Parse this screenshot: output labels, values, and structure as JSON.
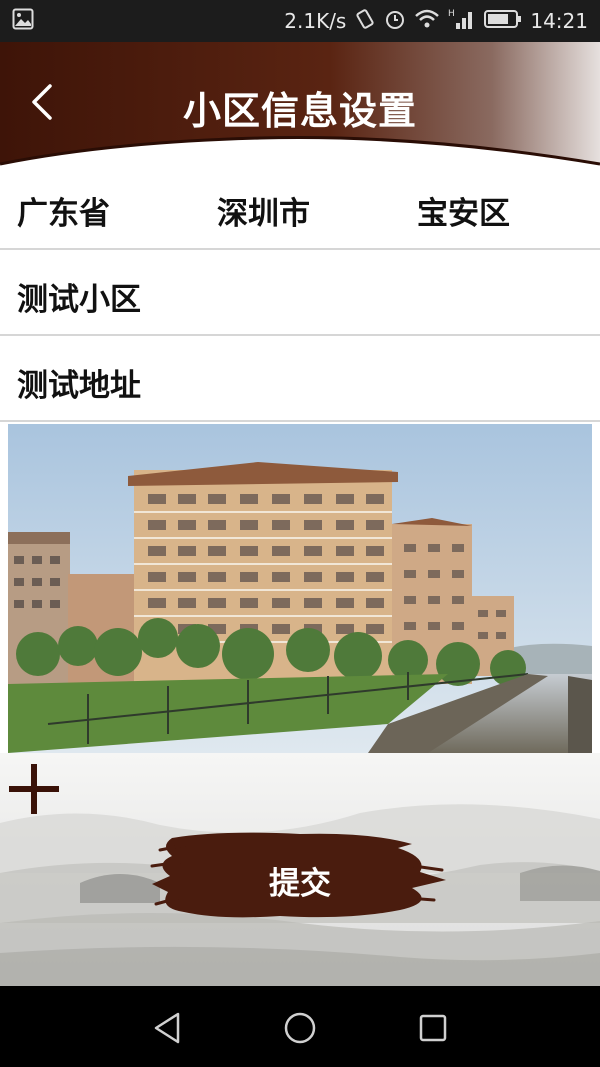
{
  "status_bar": {
    "speed": "2.1K/s",
    "time": "14:21",
    "icons": [
      "gallery-icon",
      "vibrate-icon",
      "alarm-icon",
      "wifi-icon",
      "signal-icon",
      "battery-icon"
    ]
  },
  "header": {
    "title": "小区信息设置",
    "back_icon": "back-arrow-icon"
  },
  "region": {
    "province": "广东省",
    "city": "深圳市",
    "district": "宝安区"
  },
  "community_name": "测试小区",
  "address": "测试地址",
  "photo": {
    "subject": "residential-buildings"
  },
  "add_icon": "plus-icon",
  "submit_label": "提交",
  "colors": {
    "brand_brown": "#4a1c0e",
    "ink_dark": "#3a1208"
  },
  "nav_bar": {
    "icons": [
      "back-triangle-icon",
      "home-circle-icon",
      "recents-square-icon"
    ]
  }
}
